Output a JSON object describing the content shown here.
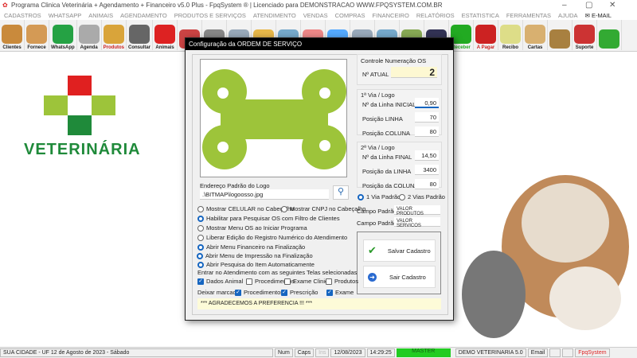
{
  "window": {
    "title": "Programa Clinica Veterinária + Agendamento + Financeiro v5.0 Plus - FpqSystem ® | Licenciado para  DEMONSTRACAO WWW.FPQSYSTEM.COM.BR",
    "minimize": "–",
    "maximize": "▢",
    "close": "✕"
  },
  "menu": [
    "CADASTROS",
    "WHATSAPP",
    "ANIMAIS",
    "AGENDAMENTO",
    "PRODUTOS E SERVIÇOS",
    "ATENDIMENTO",
    "VENDAS",
    "COMPRAS",
    "FINANCEIRO",
    "RELATÓRIOS",
    "ESTATISTICA",
    "FERRAMENTAS",
    "AJUDA"
  ],
  "menu_email": "E-MAIL",
  "toolbar": [
    {
      "label": "Clientes",
      "color": "#c98a3c"
    },
    {
      "label": "Fornece",
      "color": "#d49a55"
    },
    {
      "label": "WhatsApp",
      "color": "#25a244"
    },
    {
      "label": "Agenda",
      "color": "#aaa"
    },
    {
      "label": "Produtos",
      "color": "#d9a43a",
      "red": true
    },
    {
      "label": "Consultar",
      "color": "#666"
    },
    {
      "label": "Animais",
      "color": "#d22"
    },
    {
      "label": "",
      "color": "#c44"
    },
    {
      "label": "",
      "color": "#888"
    },
    {
      "label": "",
      "color": "#9ab"
    },
    {
      "label": "",
      "color": "#e8b84a"
    },
    {
      "label": "",
      "color": "#7ac"
    },
    {
      "label": "",
      "color": "#e88"
    },
    {
      "label": "",
      "color": "#5af"
    },
    {
      "label": "",
      "color": "#9ab"
    },
    {
      "label": "",
      "color": "#7ac"
    },
    {
      "label": "",
      "color": "#8a5"
    },
    {
      "label": "",
      "color": "#335"
    },
    {
      "label": "Receber",
      "color": "#2a2",
      "green": true
    },
    {
      "label": "A Pagar",
      "color": "#c22",
      "red": true
    },
    {
      "label": "Recibo",
      "color": "#dd8"
    },
    {
      "label": "Cartas",
      "color": "#d8b070"
    },
    {
      "label": "",
      "color": "#a88040"
    },
    {
      "label": "Suporte",
      "color": "#c33"
    },
    {
      "label": "",
      "color": "#3a3"
    }
  ],
  "desktop": {
    "logo_text": "VETERINÁRIA"
  },
  "dialog": {
    "title": "Configuração da ORDEM DE SERVIÇO",
    "numeracao": {
      "title": "Controle Numeração OS",
      "label": "Nº ATUAL",
      "value": "2"
    },
    "via1": {
      "title": "1ª Via / Logo",
      "rows": [
        {
          "label": "Nº da Linha INICIAL",
          "value": "0,90"
        },
        {
          "label": "Posição LINHA",
          "value": "70"
        },
        {
          "label": "Posição COLUNA",
          "value": "80"
        }
      ]
    },
    "via2": {
      "title": "2ª Via / Logo",
      "rows": [
        {
          "label": "Nº da Linha FINAL",
          "value": "14,50"
        },
        {
          "label": "Posição da LINHA",
          "value": "3400"
        },
        {
          "label": "Posição da COLUNA",
          "value": "80"
        }
      ]
    },
    "via_radios": [
      {
        "label": "1 Via Padrão",
        "checked": true
      },
      {
        "label": "2 Vias Padrão",
        "checked": false
      }
    ],
    "campos": [
      {
        "label": "Campo Padrão",
        "value": "VALOR PRODUTOS"
      },
      {
        "label": "Campo Padrão",
        "value": "VALOR SERVICOS"
      }
    ],
    "save_label": "Salvar Cadastro",
    "exit_label": "Sair Cadastro",
    "logo_path_label": "Endereço Padrão do Logo",
    "logo_path": ".\\BITMAP\\logoosso.jpg",
    "options": [
      {
        "label": "Mostrar CELULAR no Cabeçalho",
        "checked": false
      },
      {
        "label": "Mostrar CNPJ no Cabeçalho",
        "checked": false
      },
      {
        "label": "Habilitar para Pesquisar OS com Filtro de Clientes",
        "checked": true
      },
      {
        "label": "Mostrar Menu OS ao Iniciar Programa",
        "checked": false
      },
      {
        "label": "Liberar Edição do Registro Numérico do Atendimento",
        "checked": false
      },
      {
        "label": "Abrir Menu Financeiro na Finalização",
        "checked": true
      },
      {
        "label": "Abrir Menu de Impressão na Finalização",
        "checked": true
      },
      {
        "label": "Abrir Pesquisa do Item Automaticamente",
        "checked": true
      }
    ],
    "screens_label": "Entrar no Atendimento com as seguintes Telas selecionadas:",
    "screens": [
      {
        "label": "Dados Animal",
        "checked": true
      },
      {
        "label": "Procedimentos",
        "checked": false
      },
      {
        "label": "Exame Clinico",
        "checked": false
      },
      {
        "label": "Produtos",
        "checked": false
      }
    ],
    "marked_label": "Deixar marcado:",
    "marked": [
      {
        "label": "Procedimentos",
        "checked": true
      },
      {
        "label": "Prescrição",
        "checked": true
      },
      {
        "label": "Exame",
        "checked": true
      }
    ],
    "footer": "*** AGRADECEMOS A PREFERENCIA !!! ***"
  },
  "status": {
    "city": "SUA CIDADE - UF 12 de Agosto de 2023 - Sábado",
    "num": "Num",
    "caps": "Caps",
    "ins": "Ins",
    "date": "12/08/2023",
    "time": "14:29:25",
    "user": "MASTER",
    "db": "DEMO VETERINARIA 5.0",
    "email": "Email",
    "brand": "FpqSystem"
  },
  "colors": {
    "accent": "#1565c0",
    "bone": "#9dc43a",
    "master": "#22cc22"
  }
}
